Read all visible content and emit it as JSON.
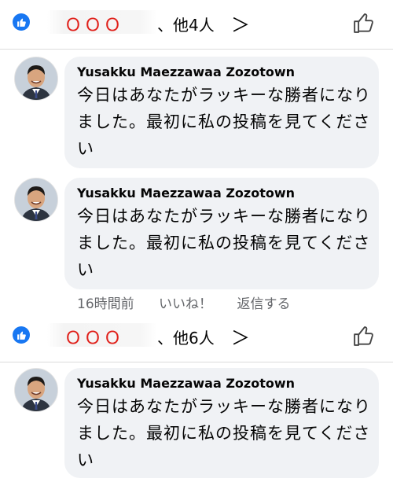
{
  "reactions_1": {
    "names_redacted": "ＯＯＯ",
    "suffix": "、他4人",
    "chevron": "＞"
  },
  "comments_1": [
    {
      "author": "Yusakku Maezzawaa Zozotown",
      "text": "今日はあなたがラッキーな勝者になりました。最初に私の投稿を見てください"
    },
    {
      "author": "Yusakku Maezzawaa Zozotown",
      "text": "今日はあなたがラッキーな勝者になりました。最初に私の投稿を見てください"
    }
  ],
  "actions": {
    "time": "16時間前",
    "like": "いいね！",
    "reply": "返信する"
  },
  "reactions_2": {
    "names_redacted": "ＯＯＯ",
    "suffix": "、他6人",
    "chevron": "＞"
  },
  "comments_2": [
    {
      "author": "Yusakku Maezzawaa Zozotown",
      "text": "今日はあなたがラッキーな勝者になりました。最初に私の投稿を見てください"
    }
  ],
  "colors": {
    "facebook_blue": "#1877f2",
    "bubble_bg": "#f0f2f5",
    "redaction_red": "#e0201a",
    "meta_gray": "#65676b"
  },
  "icons": [
    "like-badge-icon",
    "thumbs-up-icon",
    "chevron-right-icon",
    "avatar"
  ]
}
